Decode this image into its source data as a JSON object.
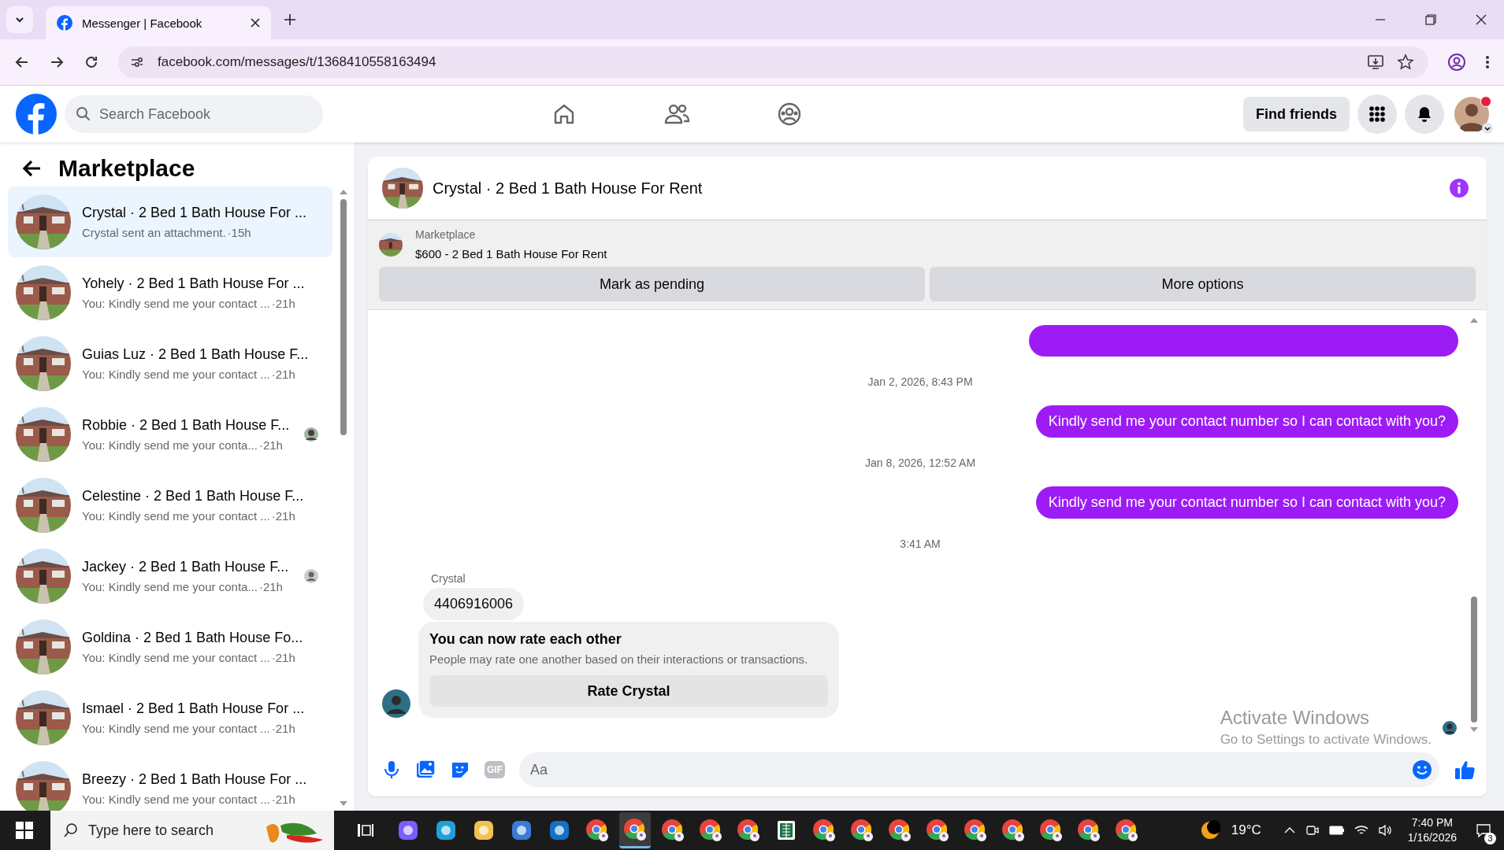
{
  "browser": {
    "tabs": [
      {
        "title": "Messenger | Facebook",
        "selected": true
      }
    ],
    "url": "facebook.com/messages/t/1368410558163494"
  },
  "header": {
    "search": {
      "placeholder": "Search Facebook"
    },
    "find_friends": "Find friends",
    "has_notification_dot": true
  },
  "sidebar": {
    "title": "Marketplace",
    "conversations": [
      {
        "name": "Crystal · 2 Bed 1 Bath House For ...",
        "preview": "Crystal sent an attachment.",
        "time": "·15h",
        "selected": true
      },
      {
        "name": "Yohely · 2 Bed 1 Bath House For ...",
        "preview": "You: Kindly send me your contact ...",
        "time": "·21h",
        "selected": false
      },
      {
        "name": "Guias Luz · 2 Bed 1 Bath House F...",
        "preview": "You: Kindly send me your contact ...",
        "time": "·21h",
        "selected": false
      },
      {
        "name": "Robbie · 2 Bed 1 Bath House F...",
        "preview": "You: Kindly send me your conta...",
        "time": "·21h",
        "selected": false
      },
      {
        "name": "Celestine · 2 Bed 1 Bath House F...",
        "preview": "You: Kindly send me your contact ...",
        "time": "·21h",
        "selected": false
      },
      {
        "name": "Jackey · 2 Bed 1 Bath House F...",
        "preview": "You: Kindly send me your conta...",
        "time": "·21h",
        "selected": false,
        "seen": {
          "kind": "default"
        }
      },
      {
        "name": "Goldina · 2 Bed 1 Bath House Fo...",
        "preview": "You: Kindly send me your contact ...",
        "time": "·21h",
        "selected": false
      },
      {
        "name": "Ismael · 2 Bed 1 Bath House For ...",
        "preview": "You: Kindly send me your contact ...",
        "time": "·21h",
        "selected": false
      },
      {
        "name": "Breezy · 2 Bed 1 Bath House For ...",
        "preview": "You: Kindly send me your contact ...",
        "time": "·21h",
        "selected": false
      }
    ]
  },
  "chat": {
    "title": "Crystal · 2 Bed 1 Bath House For Rent",
    "listing": {
      "label": "Marketplace",
      "text": "$600 - 2 Bed 1 Bath House For Rent",
      "buttons": [
        "Mark as pending",
        "More options"
      ]
    },
    "messages": [
      {
        "kind": "timestamp",
        "text": "Jan 2, 2026, 8:43 PM"
      },
      {
        "kind": "outgoing",
        "text": "Kindly send me your contact number so I can contact with you?"
      },
      {
        "kind": "timestamp",
        "text": "Jan 8, 2026, 12:52 AM"
      },
      {
        "kind": "outgoing",
        "text": "Kindly send me your contact number so I can contact with you?"
      },
      {
        "kind": "timestamp",
        "text": "3:41 AM"
      },
      {
        "kind": "sender",
        "text": "Crystal"
      },
      {
        "kind": "incoming",
        "text": "4406916006"
      },
      {
        "kind": "rating",
        "title": "You can now rate each other",
        "text": "People may rate one another based on their interactions or transactions.",
        "button": "Rate Crystal"
      }
    ],
    "composer": {
      "gif": "GIF",
      "placeholder": "Aa"
    }
  },
  "windows_notice": {
    "title": "Activate Windows",
    "text": "Go to Settings to activate Windows."
  },
  "taskbar": {
    "search_placeholder": "Type here to search",
    "apps": [
      {
        "kind": "copilot",
        "selected": false
      },
      {
        "kind": "edge",
        "selected": false
      },
      {
        "kind": "explorer",
        "selected": false
      },
      {
        "kind": "store",
        "selected": false
      },
      {
        "kind": "outlook",
        "selected": false
      },
      {
        "kind": "chrome",
        "selected": false
      },
      {
        "kind": "chrome",
        "selected": true
      },
      {
        "kind": "chrome",
        "selected": false
      },
      {
        "kind": "chrome",
        "selected": false
      },
      {
        "kind": "chrome",
        "selected": false
      },
      {
        "kind": "excel",
        "selected": false
      },
      {
        "kind": "chrome",
        "selected": false
      },
      {
        "kind": "chrome",
        "selected": false
      },
      {
        "kind": "chrome",
        "selected": false
      },
      {
        "kind": "chrome",
        "selected": false
      },
      {
        "kind": "chrome",
        "selected": false
      },
      {
        "kind": "chrome",
        "selected": false
      },
      {
        "kind": "chrome",
        "selected": false
      },
      {
        "kind": "chrome",
        "selected": false
      },
      {
        "kind": "chrome",
        "selected": false
      }
    ],
    "temperature": "19°C",
    "time": "7:40 PM",
    "date": "1/16/2026",
    "notifications": "3"
  }
}
